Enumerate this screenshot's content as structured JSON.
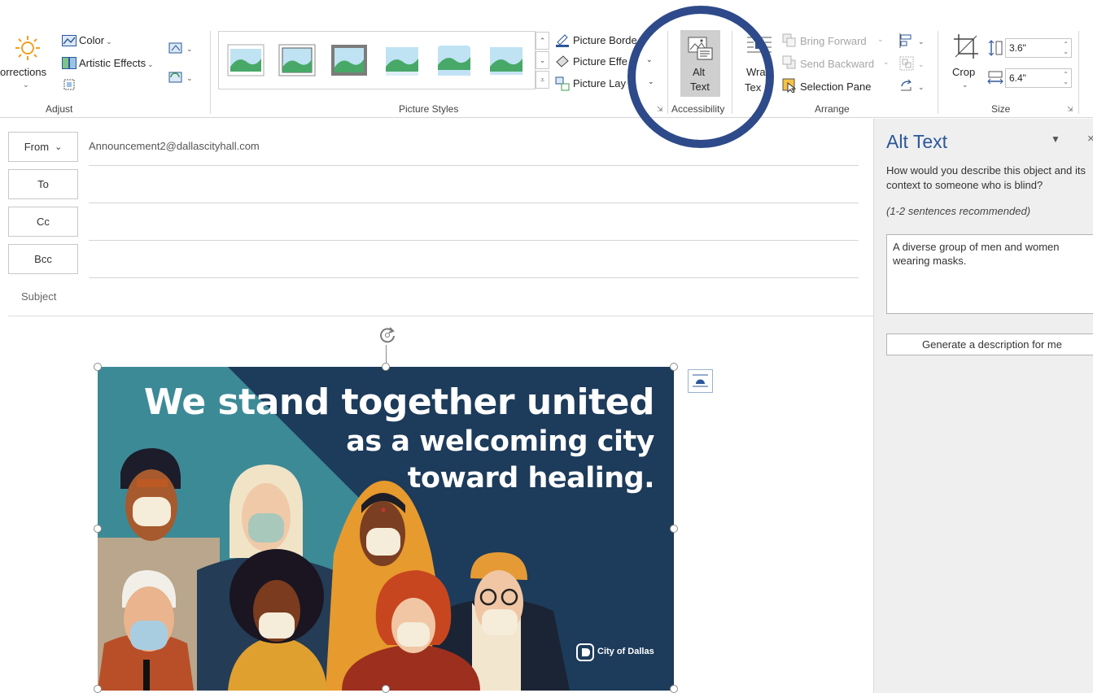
{
  "ribbon": {
    "adjust": {
      "corrections_label": "orrections",
      "color_label": "Color",
      "artistic_effects_label": "Artistic Effects",
      "group_label": "Adjust"
    },
    "picture_styles": {
      "border_label": "Picture Borde",
      "effects_label": "Picture Effe",
      "layout_label": "Picture Lay",
      "group_label": "Picture Styles"
    },
    "accessibility": {
      "alt_text_line1": "Alt",
      "alt_text_line2": "Text",
      "group_label": "Accessibility"
    },
    "arrange": {
      "wrap_text_line1": "Wra",
      "wrap_text_line2": "Tex",
      "bring_forward_label": "Bring Forward",
      "send_backward_label": "Send Backward",
      "selection_pane_label": "Selection Pane",
      "group_label": "Arrange"
    },
    "size": {
      "crop_label": "Crop",
      "height_value": "3.6\"",
      "width_value": "6.4\"",
      "group_label": "Size"
    }
  },
  "message": {
    "from_label": "From",
    "from_value": "Announcement2@dallascityhall.com",
    "to_label": "To",
    "cc_label": "Cc",
    "bcc_label": "Bcc",
    "subject_label": "Subject"
  },
  "poster": {
    "line1": "We stand together united",
    "line2": "as a welcoming city",
    "line3": "toward healing.",
    "logo_text": "City of Dallas"
  },
  "alt_pane": {
    "title": "Alt Text",
    "question": "How would you describe this object and its context to someone who is blind?",
    "hint": "(1-2 sentences recommended)",
    "description": "A diverse group of men and women wearing masks.",
    "generate_button": "Generate a description for me"
  },
  "colors": {
    "highlight_ring": "#2e4a8a",
    "pane_title": "#2b579a",
    "poster_bg": "#1d3b5a",
    "poster_teal": "#3d8a97"
  }
}
